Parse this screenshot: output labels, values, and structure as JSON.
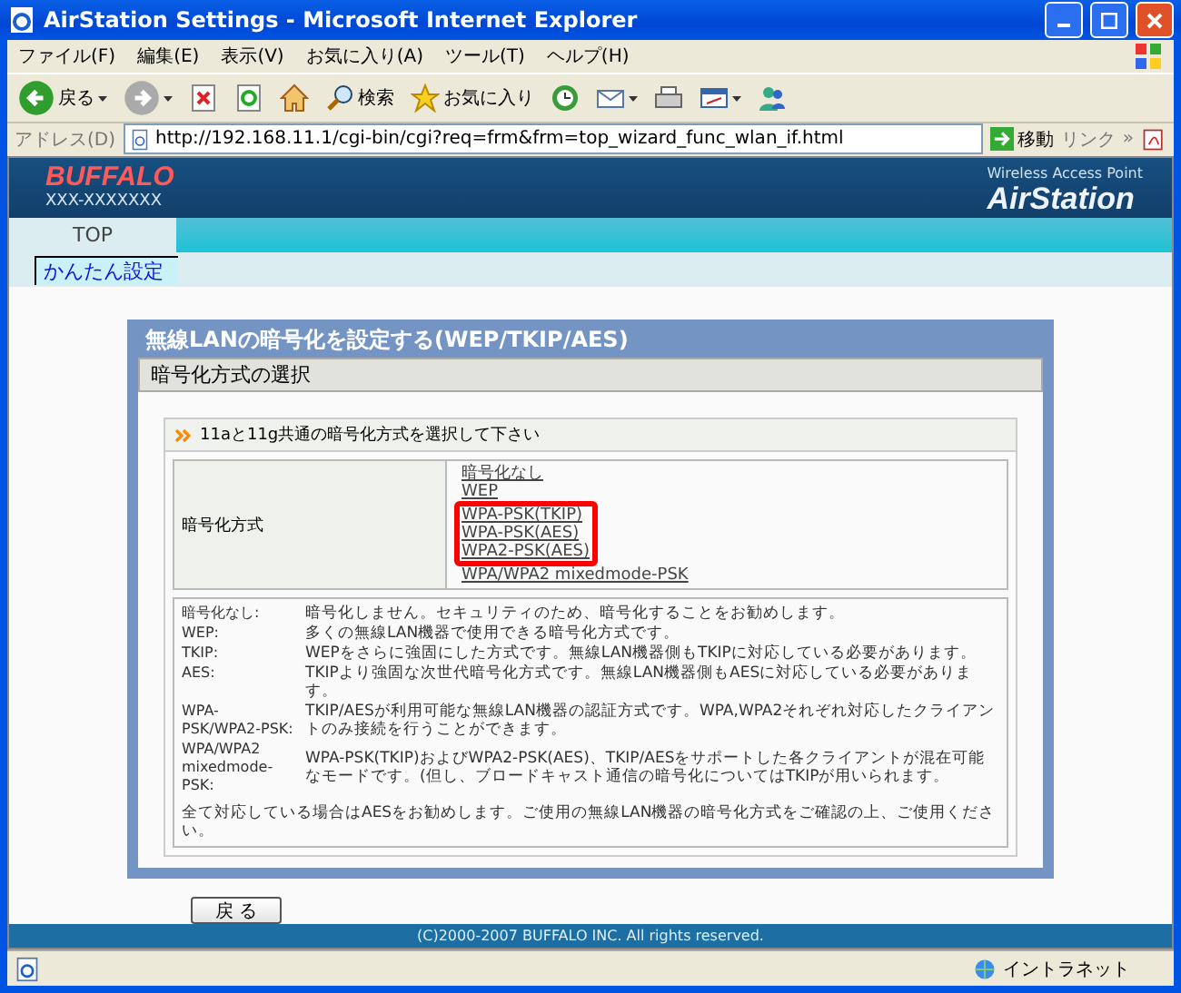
{
  "window": {
    "title": "AirStation Settings - Microsoft Internet Explorer"
  },
  "menu": [
    {
      "label": "ファイル(F)"
    },
    {
      "label": "編集(E)"
    },
    {
      "label": "表示(V)"
    },
    {
      "label": "お気に入り(A)"
    },
    {
      "label": "ツール(T)"
    },
    {
      "label": "ヘルプ(H)"
    }
  ],
  "toolbar": [
    {
      "kind": "back",
      "label": "戻る",
      "dropdown": true
    },
    {
      "kind": "forward",
      "dropdown": true
    },
    {
      "kind": "stop"
    },
    {
      "kind": "refresh"
    },
    {
      "kind": "home"
    },
    {
      "kind": "search",
      "label": "検索"
    },
    {
      "kind": "favorites",
      "label": "お気に入り"
    },
    {
      "kind": "history"
    },
    {
      "kind": "mail",
      "dropdown": true
    },
    {
      "kind": "print"
    },
    {
      "kind": "edit",
      "dropdown": true
    },
    {
      "kind": "messenger"
    }
  ],
  "address": {
    "label": "アドレス(D)",
    "url": "http://192.168.11.1/cgi-bin/cgi?req=frm&frm=top_wizard_func_wlan_if.html",
    "go": "移動",
    "links": "リンク",
    "links_more": "»"
  },
  "header": {
    "logo": "BUFFALO",
    "model": "XXX-XXXXXXX",
    "tagline": "Wireless Access Point",
    "product": "AirStation"
  },
  "tabs": [
    {
      "label": "TOP",
      "selected": true
    }
  ],
  "subnav": [
    {
      "label": "かんたん設定",
      "selected": true
    }
  ],
  "panel": {
    "title": "無線LANの暗号化を設定する(WEP/TKIP/AES)",
    "section": "暗号化方式の選択",
    "instruction": "11aと11g共通の暗号化方式を選択して下さい",
    "field_label": "暗号化方式",
    "options": [
      {
        "label": "暗号化なし",
        "highlighted": false
      },
      {
        "label": "WEP",
        "highlighted": false
      },
      {
        "label": "WPA-PSK(TKIP)",
        "highlighted": true
      },
      {
        "label": "WPA-PSK(AES)",
        "highlighted": true
      },
      {
        "label": "WPA2-PSK(AES)",
        "highlighted": true
      },
      {
        "label": "WPA/WPA2 mixedmode-PSK",
        "highlighted": false
      }
    ],
    "descriptions": [
      {
        "term": "暗号化なし:",
        "text": "暗号化しません。セキュリティのため、暗号化することをお勧めします。"
      },
      {
        "term": "WEP:",
        "text": "多くの無線LAN機器で使用できる暗号化方式です。"
      },
      {
        "term": "TKIP:",
        "text": "WEPをさらに強固にした方式です。無線LAN機器側もTKIPに対応している必要があります。"
      },
      {
        "term": "AES:",
        "text": "TKIPより強固な次世代暗号化方式です。無線LAN機器側もAESに対応している必要があります。"
      },
      {
        "term": "WPA-PSK/WPA2-PSK:",
        "text": "TKIP/AESが利用可能な無線LAN機器の認証方式です。WPA,WPA2それぞれ対応したクライアントのみ接続を行うことができます。"
      },
      {
        "term": "WPA/WPA2 mixedmode-PSK:",
        "text": "WPA-PSK(TKIP)およびWPA2-PSK(AES)、TKIP/AESをサポートした各クライアントが混在可能なモードです。(但し、ブロードキャスト通信の暗号化についてはTKIPが用いられます。"
      }
    ],
    "note": "全て対応している場合はAESをお勧めします。ご使用の無線LAN機器の暗号化方式をご確認の上、ご使用ください。"
  },
  "back_button": "戻 る",
  "footer": "(C)2000-2007 BUFFALO INC. All rights reserved.",
  "status_bar": {
    "zone": "イントラネット"
  }
}
